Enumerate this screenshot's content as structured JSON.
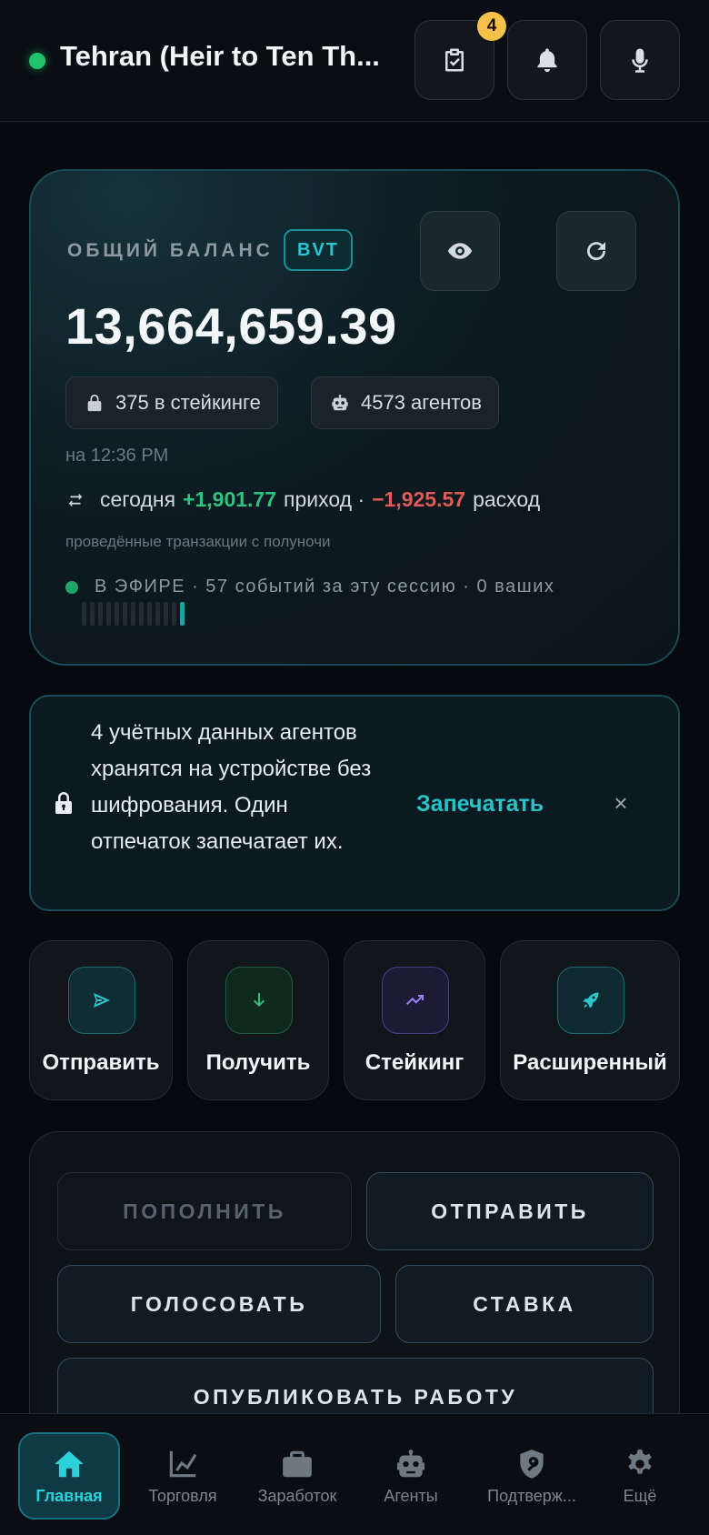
{
  "header": {
    "title": "Tehran (Heir to Ten Th...",
    "tasks_badge": "4"
  },
  "balance": {
    "label": "ОБЩИЙ БАЛАНС",
    "currency": "BVT",
    "amount": "13,664,659.39",
    "staking_chip": "375 в стейкинге",
    "agents_chip": "4573 агентов",
    "as_of": "на 12:36 PM",
    "today_label": "сегодня",
    "income": "+1,901.77",
    "income_label": "приход ·",
    "expense": "−1,925.57",
    "expense_label": "расход",
    "today_note": "проведённые транзакции с полуночи",
    "live": "В ЭФИРЕ · 57 событий за эту сессию · 0 ваших"
  },
  "notice": {
    "text": "4 учётных данных агентов хранятся на устройстве без шифрования. Один отпечаток запечатает их.",
    "action": "Запечатать",
    "close": "×"
  },
  "quick_actions": [
    {
      "label": "Отправить",
      "icon": "send-icon"
    },
    {
      "label": "Получить",
      "icon": "receive-icon"
    },
    {
      "label": "Стейкинг",
      "icon": "trending-up-icon"
    },
    {
      "label": "Расширенный",
      "icon": "rocket-icon"
    }
  ],
  "operations": {
    "topup": "ПОПОЛНИТЬ",
    "send": "ОТПРАВИТЬ",
    "vote": "ГОЛОСОВАТЬ",
    "stake": "СТАВКА",
    "publish": "ОПУБЛИКОВАТЬ РАБОТУ"
  },
  "nav": {
    "home": "Главная",
    "trade": "Торговля",
    "earn": "Заработок",
    "agents": "Агенты",
    "verify": "Подтверж...",
    "more": "Ещё"
  },
  "colors": {
    "accent": "#27c3ca",
    "income": "#2ec27e",
    "expense": "#e05a58",
    "badge": "#f5c14a"
  }
}
